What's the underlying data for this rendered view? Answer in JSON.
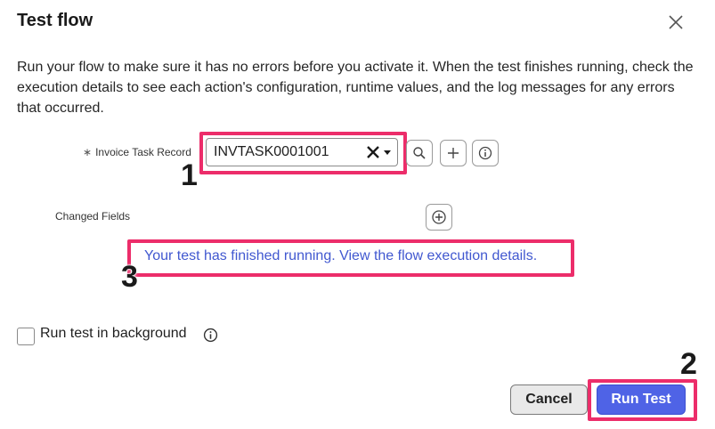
{
  "dialog": {
    "title": "Test flow",
    "description": "Run your flow to make sure it has no errors before you activate it. When the test finishes running, check the execution details to see each action's configuration, runtime values, and the log messages for any errors that occurred."
  },
  "form": {
    "required_marker": "∗",
    "record_label": "Invoice Task Record",
    "record_value": "INVTASK0001001",
    "changed_fields_label": "Changed Fields"
  },
  "status_link": "Your test has finished running. View the flow execution details.",
  "background_option": {
    "label": "Run test in background",
    "checked": false
  },
  "buttons": {
    "cancel": "Cancel",
    "run": "Run Test"
  },
  "annotations": {
    "marker_1": "1",
    "marker_2": "2",
    "marker_3": "3"
  },
  "colors": {
    "highlight": "#ec2d6a",
    "primary": "#4f63e6",
    "link": "#4158d0"
  },
  "icons": {
    "close": "close-icon",
    "clear": "clear-x-icon",
    "dropdown": "caret-down-icon",
    "search": "search-icon",
    "add": "plus-icon",
    "info": "info-icon",
    "add_field": "plus-circle-icon"
  }
}
